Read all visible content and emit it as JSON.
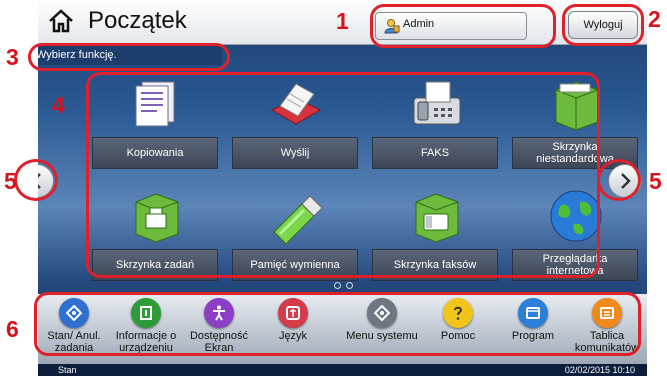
{
  "header": {
    "title": "Początek",
    "user": "Admin",
    "logout": "Wyloguj"
  },
  "message": "Wybierz funkcję.",
  "tiles": [
    {
      "label": "Kopiowania",
      "icon": "copy-icon"
    },
    {
      "label": "Wyślij",
      "icon": "send-icon"
    },
    {
      "label": "FAKS",
      "icon": "fax-icon"
    },
    {
      "label": "Skrzynka niestandardowa",
      "icon": "custom-box-icon"
    },
    {
      "label": "Skrzynka zadań",
      "icon": "job-box-icon"
    },
    {
      "label": "Pamięć wymienna",
      "icon": "usb-memory-icon"
    },
    {
      "label": "Skrzynka faksów",
      "icon": "fax-box-icon"
    },
    {
      "label": "Przeglądarka internetowa",
      "icon": "globe-icon"
    }
  ],
  "bottom_bar": [
    {
      "label": "Stan/ Anul. zadania",
      "icon": "status-icon",
      "color": "#2f6fd0"
    },
    {
      "label": "Informacje o urządzeniu",
      "icon": "device-info-icon",
      "color": "#2e9b3a"
    },
    {
      "label": "Dostępność Ekran",
      "icon": "accessibility-icon",
      "color": "#8b3fc7"
    },
    {
      "label": "Język",
      "icon": "language-icon",
      "color": "#d33a4a"
    },
    {
      "label": "Menu systemu",
      "icon": "system-menu-icon",
      "color": "#6f7682"
    },
    {
      "label": "Pomoc",
      "icon": "help-icon",
      "color": "#f0c419"
    },
    {
      "label": "Program",
      "icon": "program-icon",
      "color": "#2c7fd8"
    },
    {
      "label": "Tablica komunikatów",
      "icon": "message-board-icon",
      "color": "#f08a1c"
    }
  ],
  "status": {
    "label": "Stan",
    "datetime": "02/02/2015 10:10"
  },
  "callouts": [
    "1",
    "2",
    "3",
    "4",
    "5",
    "5",
    "6"
  ],
  "colors": {
    "callout": "#e0202a",
    "callout_number": "#d5141d"
  }
}
